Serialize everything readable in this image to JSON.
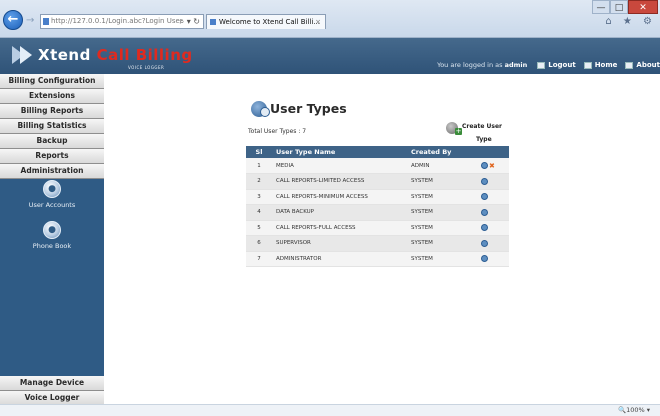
{
  "browser": {
    "address": "http://127.0.0.1/Login.abc?Login User",
    "address_host": "127.0.0.1",
    "address_controls": "⌕ ▾ ↻",
    "tab_title": "Welcome to Xtend Call Billi...",
    "tab_close": "×",
    "back": "←",
    "forward": "→",
    "right_icons": "⌂ ★ ⚙",
    "window_min": "—",
    "window_max": "□",
    "window_close": "✕"
  },
  "header": {
    "logo_xtend": "Xtend",
    "logo_call_billing": "Call Billing",
    "logo_sub": "VOICE LOGGER",
    "logged_in_prefix": "You are logged in as",
    "username": "admin",
    "links": [
      {
        "label": "Logout",
        "icon": "logout-icon"
      },
      {
        "label": "Home",
        "icon": "home-icon"
      },
      {
        "label": "About",
        "icon": "about-icon"
      }
    ]
  },
  "sidebar": {
    "nav": [
      "Billing Configuration",
      "Extensions",
      "Billing Reports",
      "Billing Statistics",
      "Backup",
      "Reports",
      "Administration"
    ],
    "sub_items": [
      {
        "label": "User Accounts",
        "icon": "user-accounts-icon"
      },
      {
        "label": "Phone Book",
        "icon": "phone-book-icon"
      }
    ],
    "bottom_nav": [
      "Manage Device",
      "Voice Logger"
    ]
  },
  "main": {
    "title": "User Types",
    "total_label": "Total User Types :",
    "total_value": "7",
    "create_label_line1": "Create User",
    "create_label_line2": "Type",
    "columns": [
      "Sl",
      "User Type Name",
      "Created By",
      ""
    ],
    "rows": [
      {
        "sl": "1",
        "name": "MEDIA",
        "created_by": "ADMIN",
        "deletable": true
      },
      {
        "sl": "2",
        "name": "CALL REPORTS-LIMITED ACCESS",
        "created_by": "SYSTEM",
        "deletable": false
      },
      {
        "sl": "3",
        "name": "CALL REPORTS-MINIMUM ACCESS",
        "created_by": "SYSTEM",
        "deletable": false
      },
      {
        "sl": "4",
        "name": "DATA BACKUP",
        "created_by": "SYSTEM",
        "deletable": false
      },
      {
        "sl": "5",
        "name": "CALL REPORTS-FULL ACCESS",
        "created_by": "SYSTEM",
        "deletable": false
      },
      {
        "sl": "6",
        "name": "SUPERVISOR",
        "created_by": "SYSTEM",
        "deletable": false
      },
      {
        "sl": "7",
        "name": "ADMINISTRATOR",
        "created_by": "SYSTEM",
        "deletable": false
      }
    ]
  },
  "statusbar": {
    "zoom": "🔍100%  ▾"
  }
}
